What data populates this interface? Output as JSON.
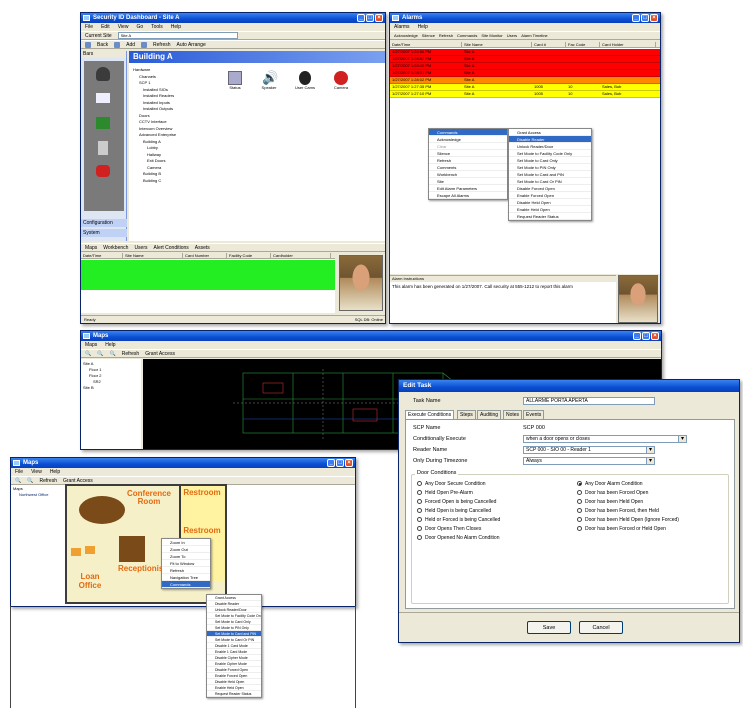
{
  "win1": {
    "title": "Security ID Dashboard - Site A",
    "menu": [
      "File",
      "Edit",
      "View",
      "Go",
      "Tools",
      "Help"
    ],
    "current_site_label": "Current Site",
    "current_site_value": "Site A",
    "toolbar": [
      "Back",
      "Add",
      "Refresh",
      "Auto Arrange"
    ],
    "sidebar_header": "Bars",
    "sidebar_items": [
      "Configuration",
      "System"
    ],
    "pane_title": "Building A",
    "tree": [
      "Hardware",
      "Channels",
      "SCP 1",
      "Installed SIOs",
      "Installed Readers",
      "Installed Inputs",
      "Installed Outputs",
      "Doors",
      "CCTV Interface",
      "Intercom Overview",
      "Advanced Enterprise",
      "Building A",
      "Lobby",
      "Hallway",
      "Exit Doors",
      "Camera",
      "Building B",
      "Building C"
    ],
    "icons": [
      "Status",
      "Speaker",
      "User Cams",
      "Camera"
    ],
    "grid_toolbar": [
      "Maps",
      "Workbench",
      "Users",
      "Alert Conditions",
      "Assets"
    ],
    "grid_headers": [
      "Date/Time",
      "Site Name",
      "Card Number",
      "Facility Code",
      "Cardholder"
    ],
    "status_left": "Ready",
    "status_right": "SQL DB: Online"
  },
  "win2": {
    "title": "Alarms",
    "menu": [
      "Alarms",
      "Help"
    ],
    "toolbar": [
      "Acknowledge",
      "Silence",
      "Refresh",
      "Commands",
      "Site Monitor",
      "Users",
      "Alarm Timeline"
    ],
    "headers": [
      "Date/Time",
      "Site Name",
      "Card #",
      "Fac Code",
      "Card Holder"
    ],
    "rows": [
      {
        "dt": "1/27/2007 1:28:56 PM",
        "site": "Site A",
        "card": "",
        "fac": "",
        "holder": "",
        "color": "#ff0000"
      },
      {
        "dt": "1/27/2007 1:28:52 PM",
        "site": "Site A",
        "card": "",
        "fac": "",
        "holder": "",
        "color": "#ff0000"
      },
      {
        "dt": "1/27/2007 1:28:40 PM",
        "site": "Site A",
        "card": "",
        "fac": "",
        "holder": "",
        "color": "#ff0000"
      },
      {
        "dt": "1/27/2007 1:28:31 PM",
        "site": "Site A",
        "card": "",
        "fac": "",
        "holder": "",
        "color": "#ff0000"
      },
      {
        "dt": "1/27/2007 1:28:02 PM",
        "site": "Site A",
        "card": "",
        "fac": "",
        "holder": "",
        "color": "#ff8800"
      },
      {
        "dt": "1/27/2007 1:27:35 PM",
        "site": "Site A",
        "card": "1005",
        "fac": "10",
        "holder": "Sales, Bob",
        "color": "#ffff00"
      },
      {
        "dt": "1/27/2007 1:27:10 PM",
        "site": "Site A",
        "card": "1005",
        "fac": "10",
        "holder": "Sales, Bob",
        "color": "#ffff00"
      }
    ],
    "ctx1": [
      "Commands",
      "Acknowledge",
      "Clear",
      "Silence",
      "Refresh",
      "Comments",
      "Workbench",
      "Site",
      "Edit Alarm Parameters",
      "Escape All Alarms"
    ],
    "ctx2": [
      "Grant Access",
      "Disable Reader",
      "Unlock Reader/Door",
      "Set Mode to Facility Code Only",
      "Set Mode to Card Only",
      "Set Mode to PIN Only",
      "Set Mode to Card and PIN",
      "Set Mode to Card Or PIN",
      "Disable Forced Open",
      "Enable Forced Open",
      "Disable Held Open",
      "Enable Held Open",
      "Request Reader Status"
    ],
    "instructions_label": "Alarm Instructions",
    "instructions_text": "This alarm has been generated on 1/27/2007. Call security at 555-1212 to report this alarm"
  },
  "win3": {
    "title": "Maps",
    "menu": [
      "Maps",
      "Help"
    ],
    "toolbar": [
      "Refresh",
      "Grant Access"
    ],
    "tree": [
      "Site A",
      "Floor 1",
      "Floor 2",
      "SR2",
      "Site B"
    ]
  },
  "win4": {
    "title": "Maps",
    "menu": [
      "File",
      "View",
      "Help"
    ],
    "toolbar": [
      "Refresh",
      "Grant Access"
    ],
    "tree_root": "Maps",
    "tree_item": "Northwest Office",
    "rooms": {
      "conference": "Conference Room",
      "restroom1": "Restroom",
      "restroom2": "Restroom",
      "loan": "Loan Office",
      "receptionist": "Receptionist"
    },
    "ctx_small": [
      "Zoom In",
      "Zoom Out",
      "Zoom To",
      "Fit to Window",
      "Refresh",
      "Navigation Tree",
      "Commands"
    ],
    "ctx_long": [
      "Grant Access",
      "Disable Reader",
      "Unlock Reader/Door",
      "Set Mode to Facility Code Only",
      "Set Mode to Card Only",
      "Set Mode to PIN Only",
      "Set Mode to Card and PIN",
      "Set Mode to Card Or PIN",
      "Disable 1 Card Mode",
      "Enable 1 Card Mode",
      "Disable Cipher Mode",
      "Enable Cipher Mode",
      "Disable Forced Open",
      "Enable Forced Open",
      "Disable Held Open",
      "Enable Held Open",
      "Request Reader Status"
    ]
  },
  "edit": {
    "title": "Edit Task",
    "task_name_label": "Task Name",
    "task_name_value": "ALLARME PORTA APERTA",
    "tabs": [
      "Execute Conditions",
      "Steps",
      "Auditing",
      "Notes",
      "Events"
    ],
    "scp_label": "SCP Name",
    "scp_value": "SCP 000",
    "cond_label": "Conditionally Execute",
    "cond_value": "when a door opens or closes",
    "reader_label": "Reader Name",
    "reader_value": "SCP 000 - SIO 00 - Reader 1",
    "tz_label": "Only During Timezone",
    "tz_value": "Always",
    "door_group": "Door Conditions",
    "left_options": [
      "Any Door Secure Condition",
      "Held Open Pre-Alarm",
      "Forced Open is being Cancelled",
      "Held Open is being Cancelled",
      "Held or Forced is being Cancelled",
      "Door Opens Then Closes",
      "Door Opened No Alarm Condition"
    ],
    "right_options": [
      "Any Door Alarm Condition",
      "Door has been Forced Open",
      "Door has been Held Open",
      "Door has been Forced, then Held",
      "Door has been Held Open (Ignore Forced)",
      "Door has been Forced or Held Open"
    ],
    "selected_right_index": 0,
    "save_label": "Save",
    "cancel_label": "Cancel"
  }
}
